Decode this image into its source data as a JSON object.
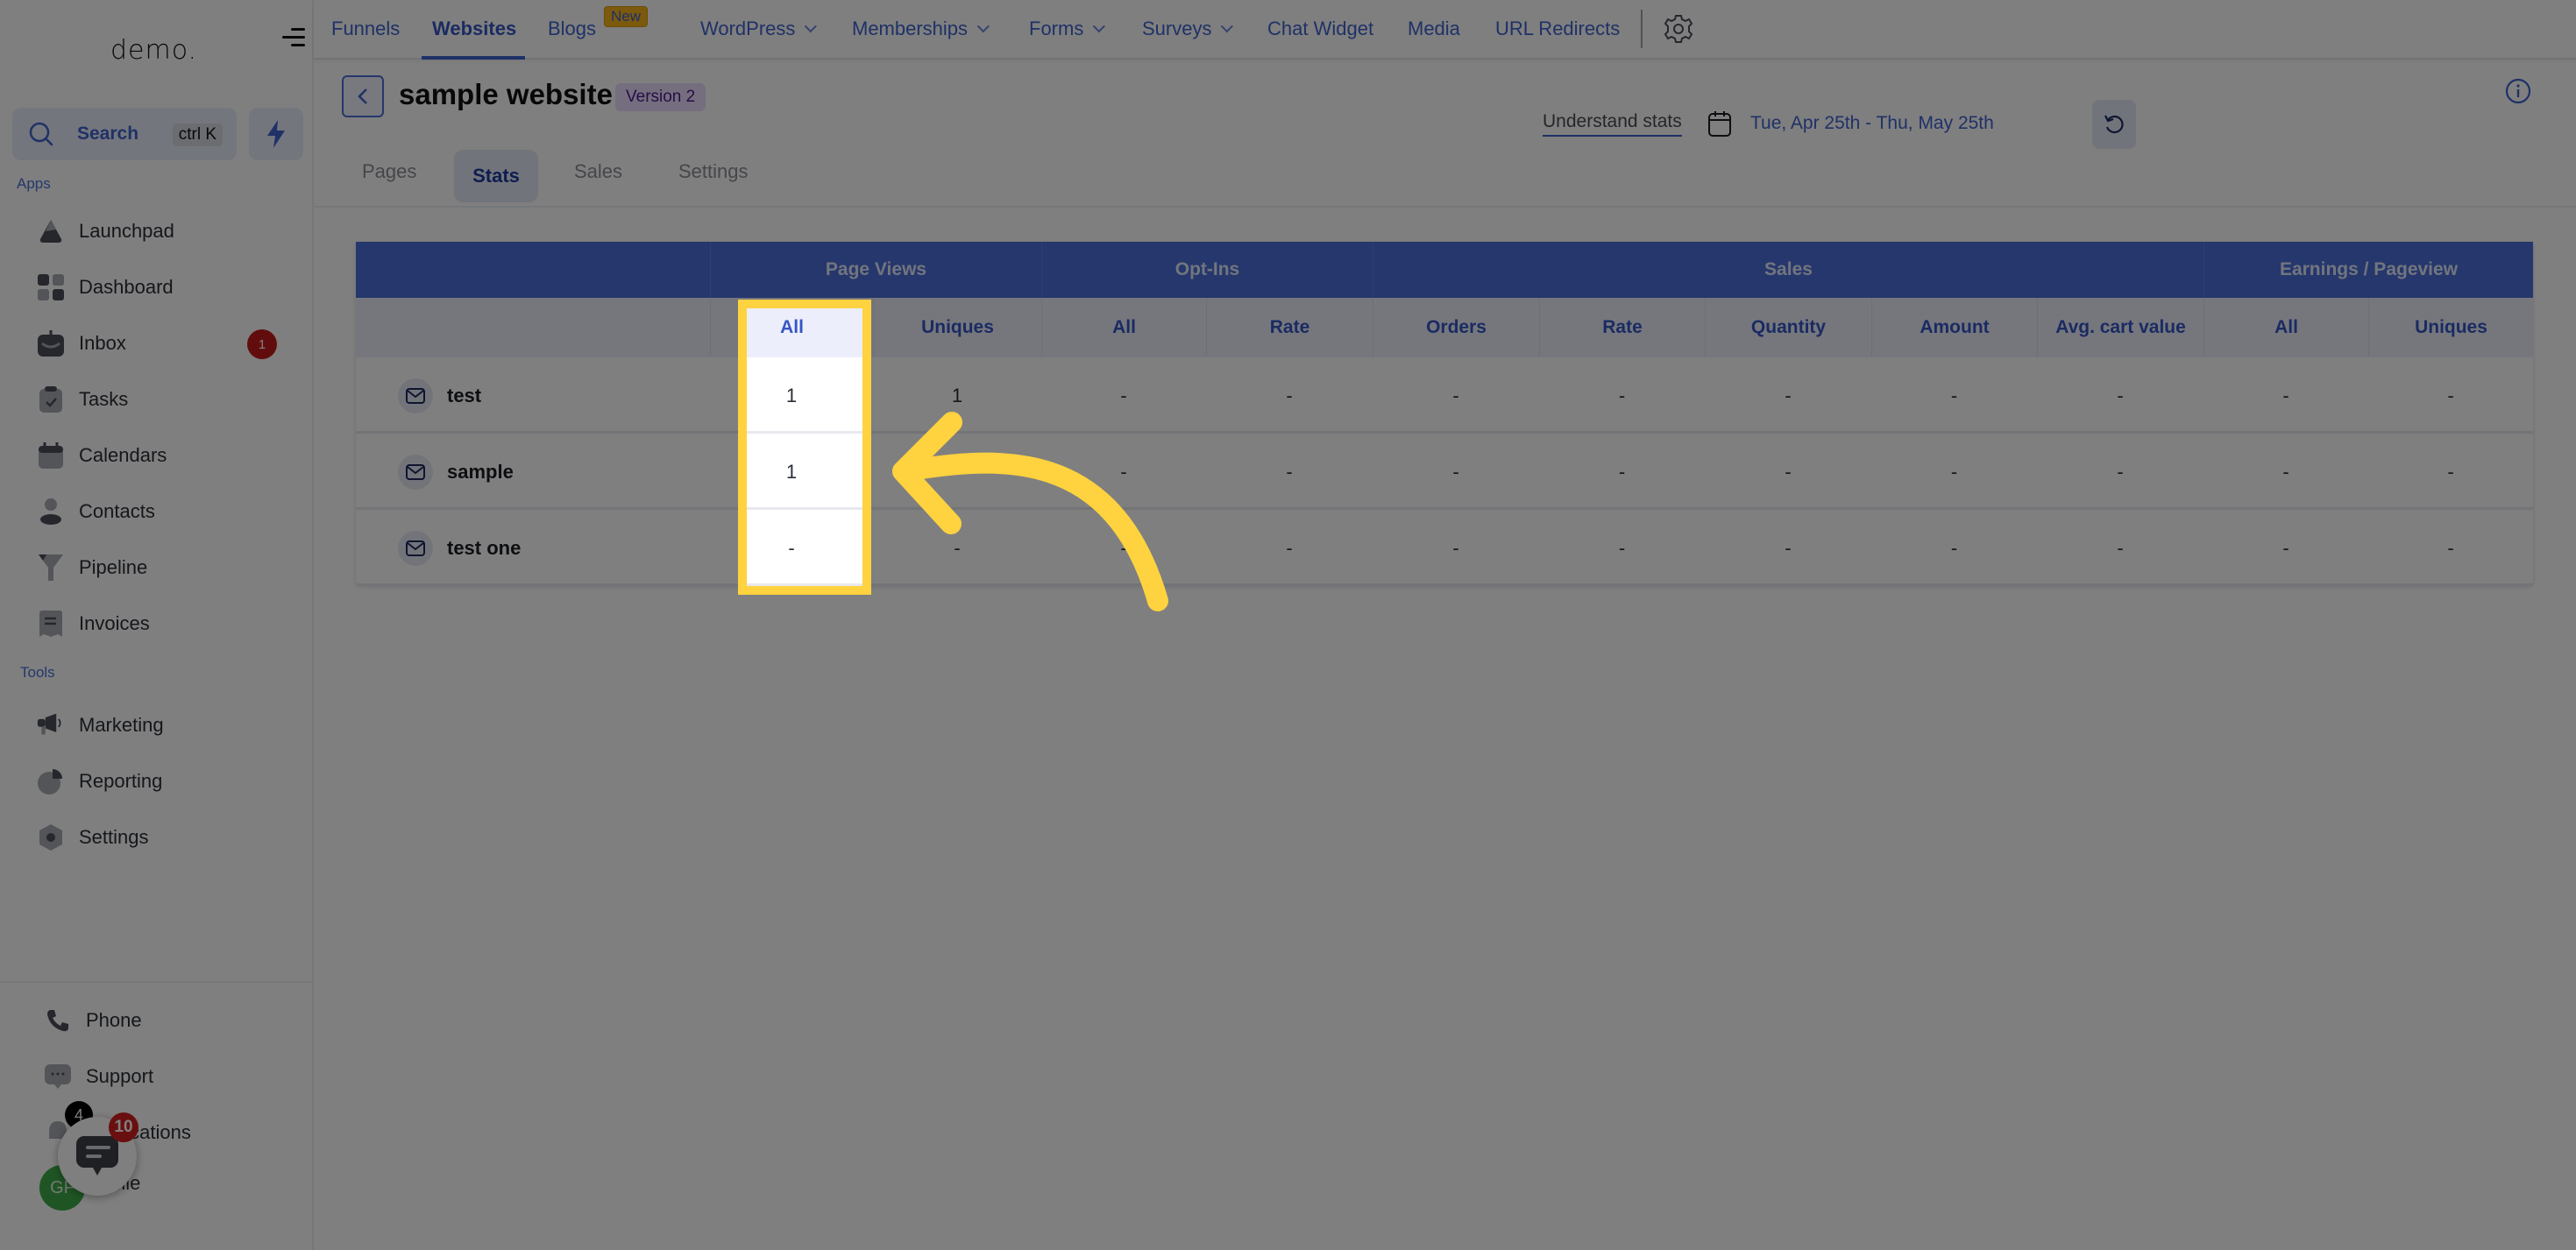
{
  "sidebar": {
    "logo": "demo.",
    "search_label": "Search",
    "search_shortcut": "ctrl K",
    "apps_label": "Apps",
    "tools_label": "Tools",
    "apps": [
      {
        "label": "Launchpad",
        "icon": "rocket-icon"
      },
      {
        "label": "Dashboard",
        "icon": "grid-icon"
      },
      {
        "label": "Inbox",
        "icon": "inbox-icon",
        "badge": "1"
      },
      {
        "label": "Tasks",
        "icon": "clipboard-check-icon"
      },
      {
        "label": "Calendars",
        "icon": "calendar-icon"
      },
      {
        "label": "Contacts",
        "icon": "user-icon"
      },
      {
        "label": "Pipeline",
        "icon": "funnel-icon"
      },
      {
        "label": "Invoices",
        "icon": "receipt-icon"
      }
    ],
    "tools": [
      {
        "label": "Marketing",
        "icon": "megaphone-icon"
      },
      {
        "label": "Reporting",
        "icon": "pie-chart-icon"
      },
      {
        "label": "Settings",
        "icon": "settings-hex-icon"
      }
    ],
    "bottom": [
      {
        "label": "Phone",
        "icon": "phone-icon"
      },
      {
        "label": "Support",
        "icon": "chat-bubble-icon"
      },
      {
        "label": "Notifications",
        "icon": "bell-icon",
        "badge": "4"
      },
      {
        "label": "Profile",
        "icon": "avatar",
        "initials": "GF"
      }
    ],
    "chat_widget_badge": "10"
  },
  "topnav": {
    "items": [
      {
        "label": "Funnels"
      },
      {
        "label": "Websites",
        "active": true
      },
      {
        "label": "Blogs",
        "badge": "New"
      },
      {
        "label": "WordPress",
        "dropdown": true
      },
      {
        "label": "Memberships",
        "dropdown": true
      },
      {
        "label": "Forms",
        "dropdown": true
      },
      {
        "label": "Surveys",
        "dropdown": true
      },
      {
        "label": "Chat Widget"
      },
      {
        "label": "Media"
      },
      {
        "label": "URL Redirects"
      }
    ]
  },
  "page": {
    "title": "sample website",
    "version_badge": "Version 2",
    "tabs": [
      "Pages",
      "Stats",
      "Sales",
      "Settings"
    ],
    "active_tab": "Stats",
    "understand_stats": "Understand stats",
    "date_range": "Tue, Apr 25th - Thu, May 25th"
  },
  "table": {
    "groups": [
      "Page Views",
      "Opt-Ins",
      "Sales",
      "Earnings / Pageview"
    ],
    "columns": [
      "All",
      "Uniques",
      "All",
      "Rate",
      "Orders",
      "Rate",
      "Quantity",
      "Amount",
      "Avg. cart value",
      "All",
      "Uniques"
    ],
    "rows": [
      {
        "name": "test",
        "values": [
          "1",
          "1",
          "-",
          "-",
          "-",
          "-",
          "-",
          "-",
          "-",
          "-",
          "-"
        ]
      },
      {
        "name": "sample",
        "values": [
          "1",
          "",
          "-",
          "-",
          "-",
          "-",
          "-",
          "-",
          "-",
          "-",
          "-"
        ]
      },
      {
        "name": "test one",
        "values": [
          "-",
          "-",
          "-",
          "-",
          "-",
          "-",
          "-",
          "-",
          "-",
          "-",
          "-"
        ]
      }
    ]
  },
  "highlight": {
    "target": "Page Views / All column",
    "color": "#ffd23f"
  },
  "colors": {
    "accent": "#4a6fd8",
    "badge_red": "#c51b1b",
    "new_badge": "#f6b51a"
  }
}
